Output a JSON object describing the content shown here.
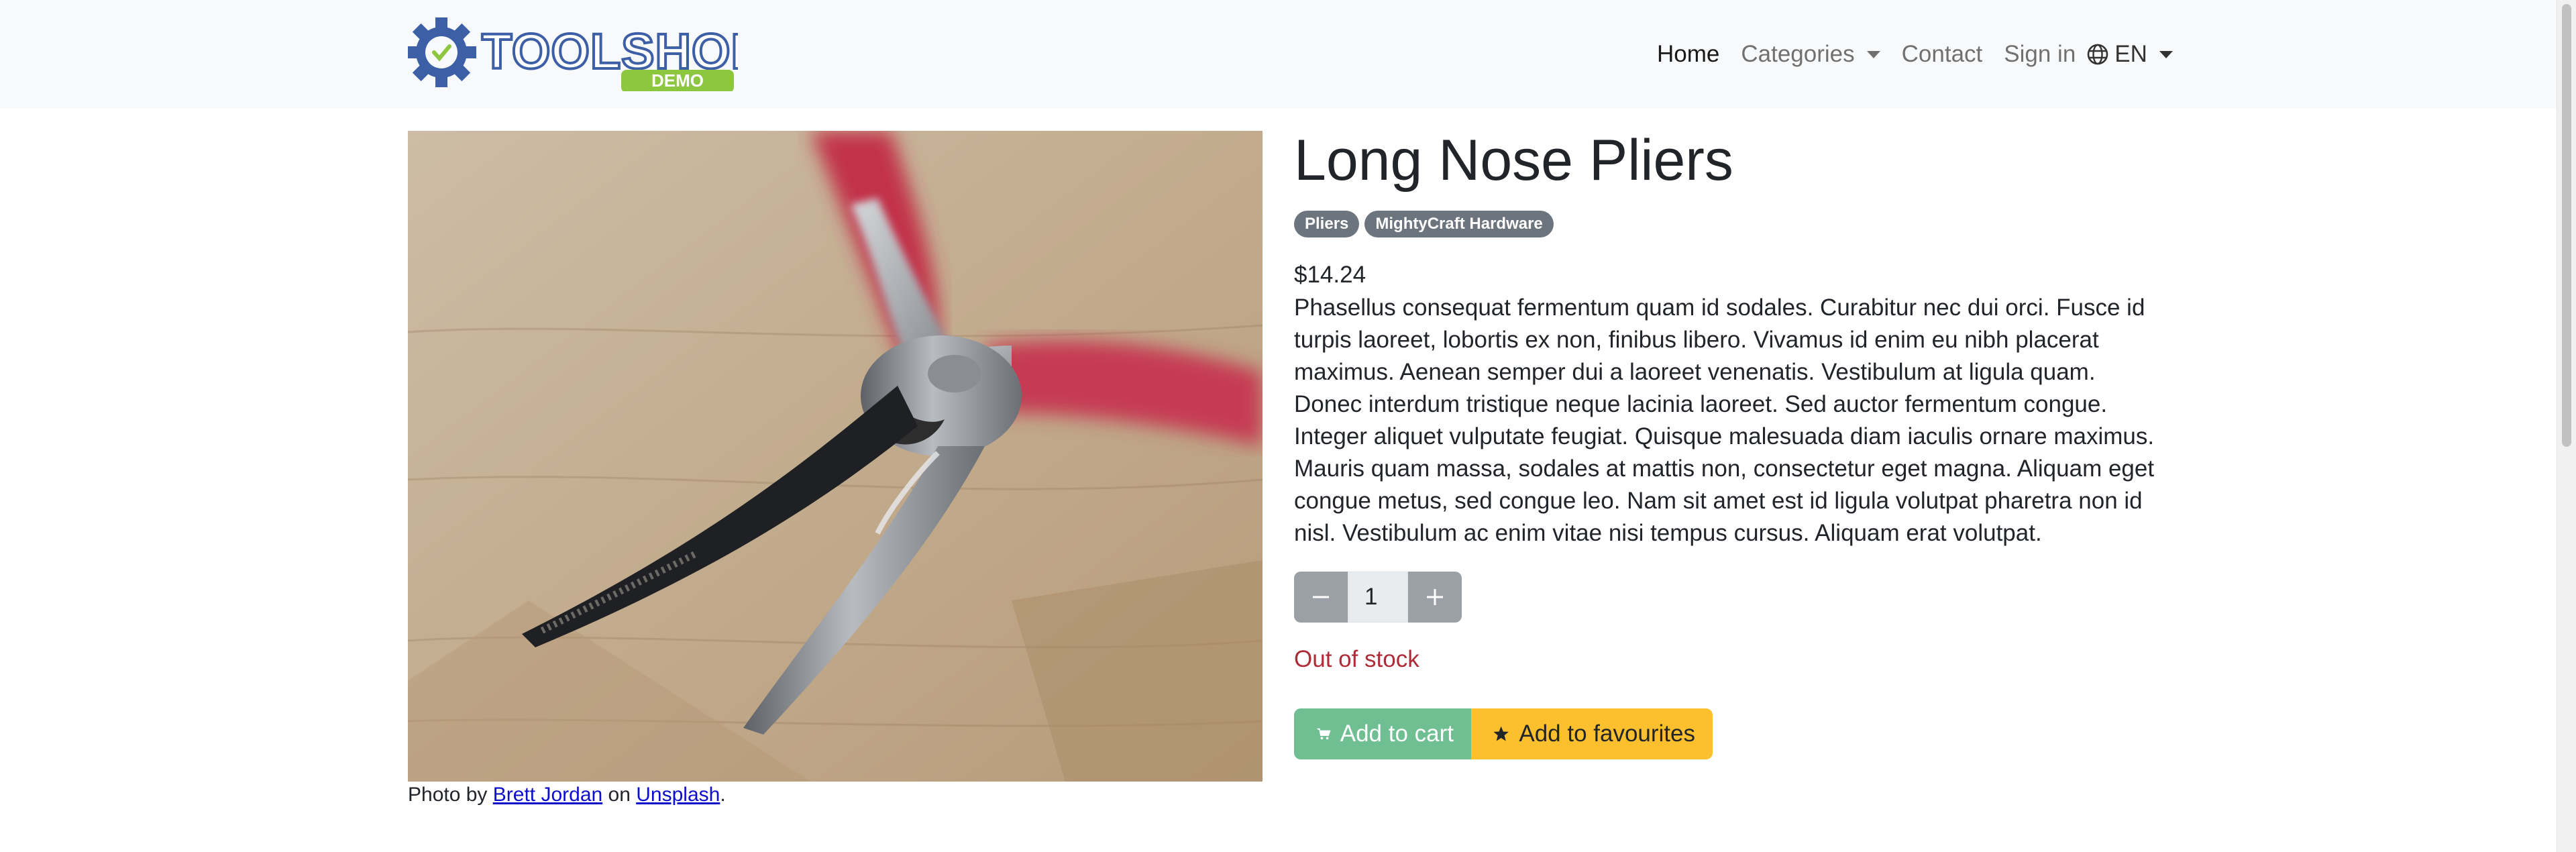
{
  "brand": {
    "name": "TOOLSHOP",
    "tag": "DEMO",
    "colors": {
      "blue": "#3c5fa6",
      "green": "#8dc63f"
    }
  },
  "nav": {
    "home": "Home",
    "categories": "Categories",
    "contact": "Contact",
    "sign_in": "Sign in",
    "language": "EN"
  },
  "product": {
    "title": "Long Nose Pliers",
    "badges": [
      "Pliers",
      "MightyCraft Hardware"
    ],
    "price": "$14.24",
    "description": "Phasellus consequat fermentum quam id sodales. Curabitur nec dui orci. Fusce id turpis laoreet, lobortis ex non, finibus libero. Vivamus id enim eu nibh placerat maximus. Aenean semper dui a laoreet venenatis. Vestibulum at ligula quam. Donec interdum tristique neque lacinia laoreet. Sed auctor fermentum congue. Integer aliquet vulputate feugiat. Quisque malesuada diam iaculis ornare maximus. Mauris quam massa, sodales at mattis non, consectetur eget magna. Aliquam eget congue metus, sed congue leo. Nam sit amet est id ligula volutpat pharetra non id nisl. Vestibulum ac enim vitae nisi tempus cursus. Aliquam erat volutpat.",
    "quantity": "1",
    "stock_status": "Out of stock",
    "add_to_cart": "Add to cart",
    "add_to_favourites": "Add to favourites"
  },
  "credit": {
    "prefix": "Photo by",
    "author": "Brett Jordan",
    "middle": "on",
    "site": "Unsplash",
    "suffix": "."
  },
  "colors": {
    "stock": "#b02a37",
    "cart_btn": "#6fbf93",
    "fav_btn": "#fcc02e",
    "badge": "#6c757d"
  }
}
